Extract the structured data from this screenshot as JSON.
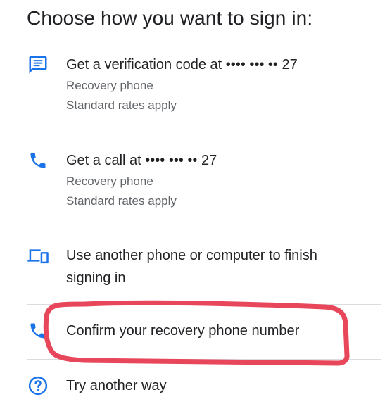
{
  "heading": "Choose how you want to sign in:",
  "options": [
    {
      "primary": "Get a verification code at •••• ••• •• 27",
      "secondary_1": "Recovery phone",
      "secondary_2": "Standard rates apply",
      "icon": "message-icon"
    },
    {
      "primary": "Get a call at •••• ••• •• 27",
      "secondary_1": "Recovery phone",
      "secondary_2": "Standard rates apply",
      "icon": "phone-icon"
    },
    {
      "primary_line_1": "Use another phone or computer to finish",
      "primary_line_2": "signing in",
      "icon": "devices-icon"
    },
    {
      "primary": "Confirm your recovery phone number",
      "icon": "phone-icon"
    },
    {
      "primary": "Try another way",
      "icon": "help-circle-icon"
    }
  ],
  "colors": {
    "accent": "#1a73e8",
    "text": "#202124",
    "secondary_text": "#5f6368",
    "divider": "#dadce0",
    "highlight": "#e8465a"
  }
}
